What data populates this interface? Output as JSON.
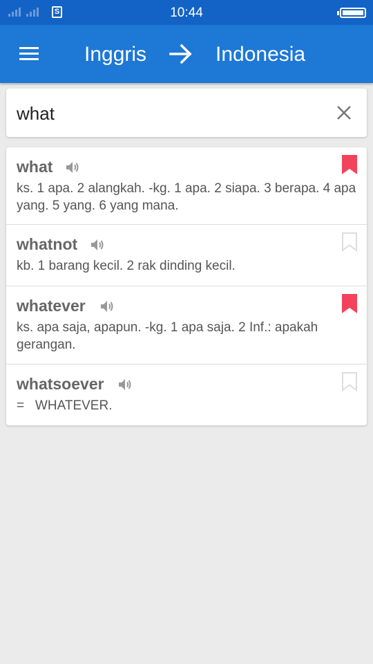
{
  "status_bar": {
    "time": "10:44",
    "sim_label": "S"
  },
  "app_bar": {
    "source_language": "Inggris",
    "target_language": "Indonesia"
  },
  "search": {
    "value": "what"
  },
  "colors": {
    "app_bar": "#1d78d6",
    "status_bar": "#1363c6",
    "bookmark_active": "#f3435c",
    "bookmark_inactive": "#dddddd"
  },
  "results": [
    {
      "word": "what",
      "definition": "ks. 1 apa. 2 alangkah. -kg. 1 apa. 2 siapa. 3 berapa. 4 apa yang. 5 yang. 6 yang mana.",
      "bookmarked": true
    },
    {
      "word": "whatnot",
      "definition": "kb. 1 barang kecil. 2 rak dinding kecil.",
      "bookmarked": false
    },
    {
      "word": "whatever",
      "definition": "ks. apa saja, apapun. -kg. 1 apa saja. 2 Inf.: apakah gerangan.",
      "bookmarked": true
    },
    {
      "word": "whatsoever",
      "definition": "=   WHATEVER.",
      "bookmarked": false
    }
  ]
}
